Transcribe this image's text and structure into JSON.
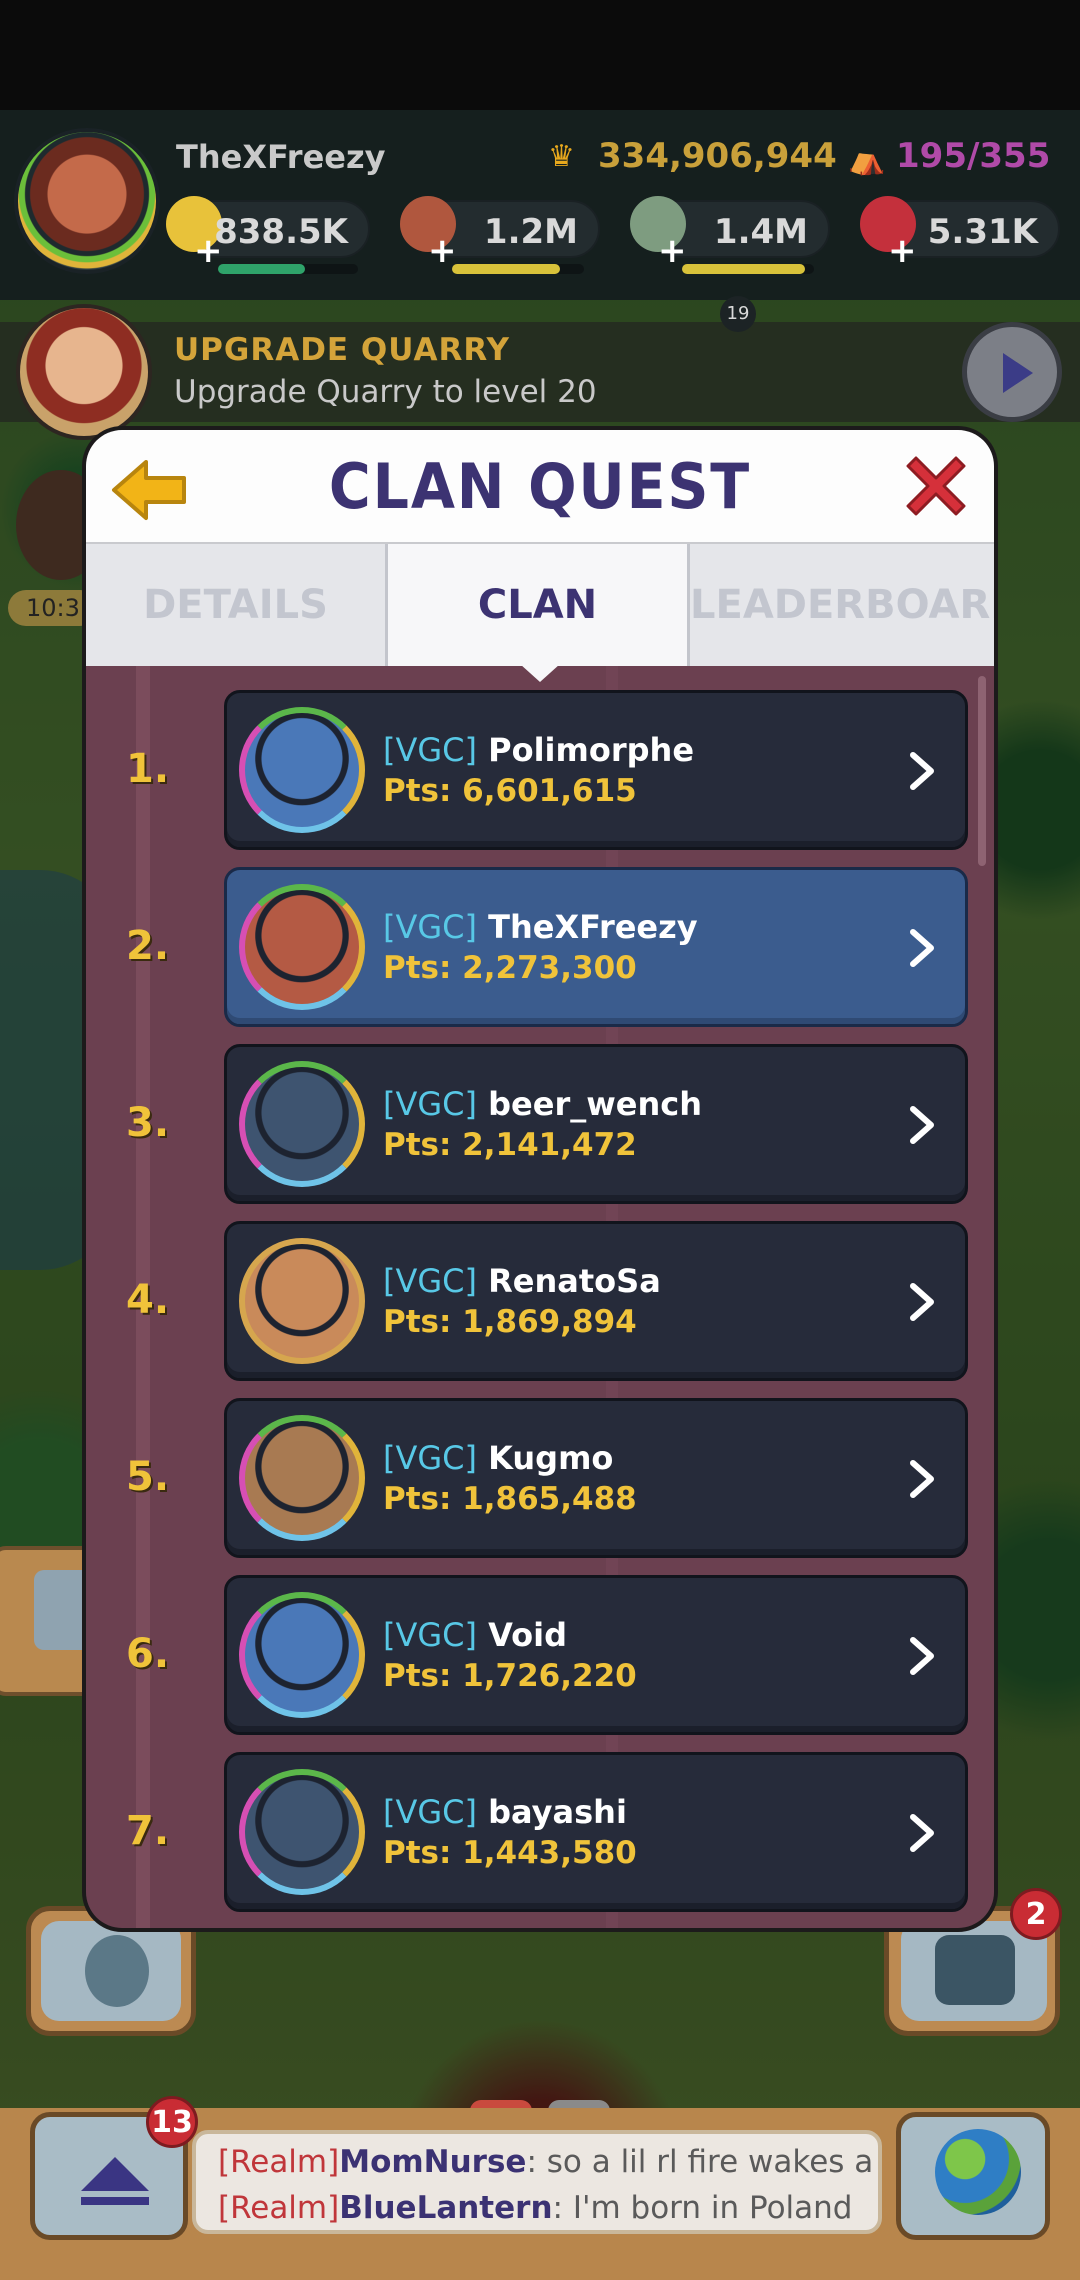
{
  "hud": {
    "player_name": "TheXFreezy",
    "trophies": "334,906,944",
    "population": "195/355",
    "resources": [
      {
        "name": "gold",
        "value": "838.5K",
        "icon": "gold-coin-icon",
        "color": "#e8c23a",
        "fill": 0.62,
        "bar_color": "#2fa36a"
      },
      {
        "name": "food",
        "value": "1.2M",
        "icon": "meat-icon",
        "color": "#b0573e",
        "fill": 0.82,
        "bar_color": "#d8c23a"
      },
      {
        "name": "stone",
        "value": "1.4M",
        "icon": "stone-icon",
        "color": "#7e9c80",
        "fill": 0.93,
        "bar_color": "#d8c23a"
      },
      {
        "name": "gems",
        "value": "5.31K",
        "icon": "ruby-icon",
        "color": "#c4303c"
      }
    ]
  },
  "quest_banner": {
    "title": "UPGRADE QUARRY",
    "subtitle": "Upgrade Quarry to level 20",
    "badge": "19"
  },
  "side": {
    "timer": "10:3"
  },
  "modal": {
    "title": "CLAN QUEST",
    "tabs": [
      {
        "label": "DETAILS",
        "active": false
      },
      {
        "label": "CLAN",
        "active": true
      },
      {
        "label": "LEADERBOARD",
        "active": false
      }
    ],
    "rows": [
      {
        "rank": "1.",
        "clan": "[VGC]",
        "name": "Polimorphe",
        "points": "Pts: 6,601,615",
        "avatar_color": "#4a78b8",
        "me": false
      },
      {
        "rank": "2.",
        "clan": "[VGC]",
        "name": "TheXFreezy",
        "points": "Pts: 2,273,300",
        "avatar_color": "#b45a44",
        "me": true
      },
      {
        "rank": "3.",
        "clan": "[VGC]",
        "name": "beer_wench",
        "points": "Pts: 2,141,472",
        "avatar_color": "#3e5470",
        "me": false
      },
      {
        "rank": "4.",
        "clan": "[VGC]",
        "name": "RenatoSa",
        "points": "Pts: 1,869,894",
        "avatar_color": "#c98a5a",
        "me": false
      },
      {
        "rank": "5.",
        "clan": "[VGC]",
        "name": "Kugmo",
        "points": "Pts: 1,865,488",
        "avatar_color": "#a87a52",
        "me": false
      },
      {
        "rank": "6.",
        "clan": "[VGC]",
        "name": "Void",
        "points": "Pts: 1,726,220",
        "avatar_color": "#4a78b8",
        "me": false
      },
      {
        "rank": "7.",
        "clan": "[VGC]",
        "name": "bayashi",
        "points": "Pts: 1,443,580",
        "avatar_color": "#3e5470",
        "me": false
      }
    ]
  },
  "notifications": {
    "right_button": "2",
    "chat_button": "13"
  },
  "chat": {
    "lines": [
      {
        "tag": "[Realm]",
        "user": "MomNurse",
        "message": ": so a lil rl fire wakes a"
      },
      {
        "tag": "[Realm]",
        "user": "BlueLantern",
        "message": ": I'm born in Poland"
      }
    ]
  },
  "colors": {
    "title": "#3c3372",
    "accent_gold": "#f0c33a",
    "clan_tag": "#58c8e6",
    "highlight_row": "#3b5c8e",
    "close_red": "#d5303a",
    "back_yellow": "#f2b417"
  }
}
